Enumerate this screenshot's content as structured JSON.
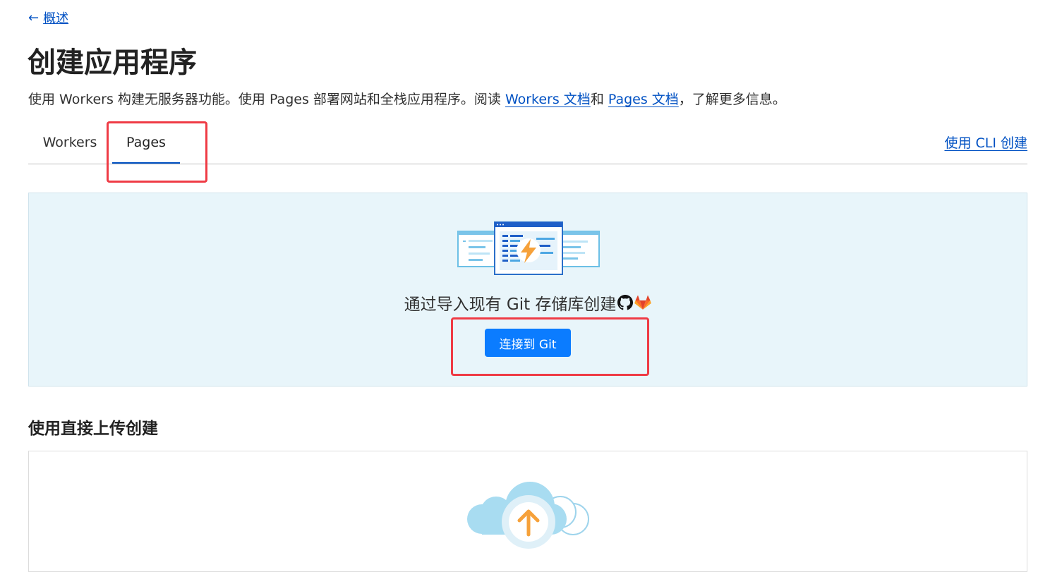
{
  "back": {
    "arrow": "←",
    "label": "概述"
  },
  "page": {
    "title": "创建应用程序"
  },
  "subtitle": {
    "part1": "使用 Workers 构建无服务器功能。使用 Pages 部署网站和全栈应用程序。阅读 ",
    "workers_link": "Workers 文档",
    "part2": "和 ",
    "pages_link": "Pages 文档",
    "part3": "，了解更多信息。"
  },
  "tabs": [
    {
      "label": "Workers",
      "active": false
    },
    {
      "label": "Pages",
      "active": true
    }
  ],
  "cli_link": "使用 CLI 创建",
  "git_section": {
    "heading": "通过导入现有 Git 存储库创建",
    "icons": [
      "github-icon",
      "gitlab-icon"
    ],
    "button_label": "连接到 Git"
  },
  "upload_section": {
    "title": "使用直接上传创建"
  },
  "colors": {
    "link": "#0051c3",
    "primary_button": "#0b7cff",
    "panel_bg": "#e8f5fa",
    "highlight": "#ef3b45",
    "accent_orange": "#f6a13a"
  }
}
